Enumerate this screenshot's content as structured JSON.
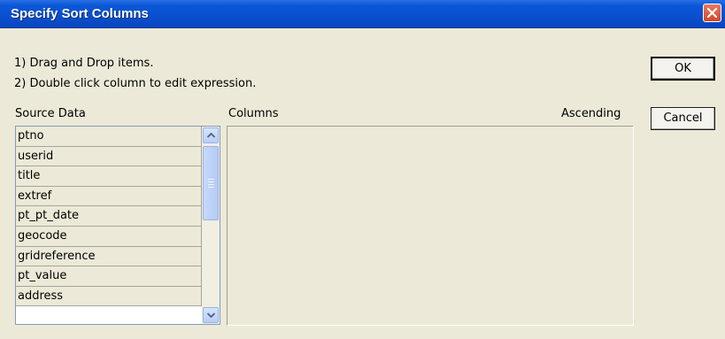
{
  "window": {
    "title": "Specify Sort Columns"
  },
  "instructions": [
    "1) Drag and Drop items.",
    "2) Double click column to edit expression."
  ],
  "buttons": {
    "ok": "OK",
    "cancel": "Cancel"
  },
  "source": {
    "label": "Source Data",
    "items": [
      "ptno",
      "userid",
      "title",
      "extref",
      "pt_pt_date",
      "geocode",
      "gridreference",
      "pt_value",
      "address"
    ]
  },
  "columns": {
    "label": "Columns",
    "ascending_label": "Ascending",
    "items": []
  },
  "colors": {
    "titlebar": "#0a4fcf",
    "dialog_bg": "#ece9d8",
    "close_button": "#d4442b",
    "scrollbar": "#b7cdf7"
  },
  "icons": {
    "close": "close-icon",
    "scroll_up": "chevron-up-icon",
    "scroll_down": "chevron-down-icon"
  }
}
